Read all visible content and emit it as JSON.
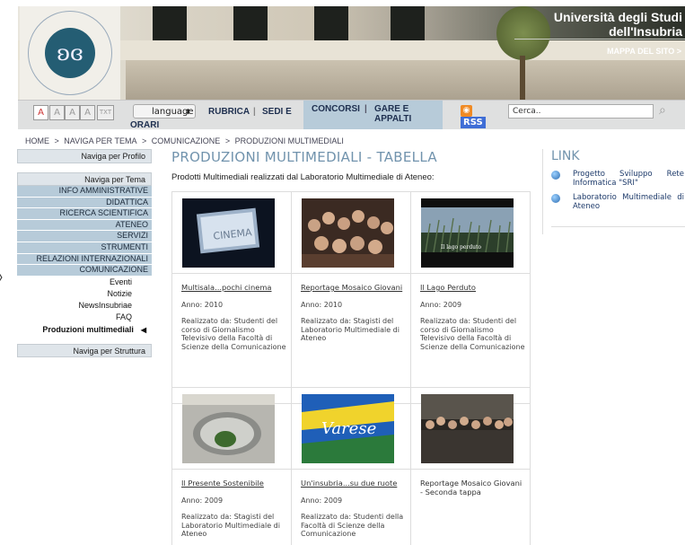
{
  "header": {
    "university_line1": "Università degli Studi",
    "university_line2": "dell'Insubria",
    "sitemap_label": "MAPPA DEL SITO >",
    "logo_ring_text": "STUDIORUM UNIVERSITAS INSUBRIAE"
  },
  "toolbar": {
    "font_buttons": [
      "A",
      "A",
      "A",
      "A",
      "TXT"
    ],
    "language_label": "language",
    "orari_label": "ORARI",
    "rubrica": "RUBRICA",
    "sedi": "SEDI E",
    "concorsi": "CONCORSI",
    "gare": "GARE E APPALTI",
    "separator": "|",
    "rss_label": "RSS",
    "search_value": "Cerca.."
  },
  "breadcrumb": [
    "HOME",
    ">",
    "NAVIGA PER TEMA",
    ">",
    "COMUNICAZIONE",
    ">",
    "PRODUZIONI MULTIMEDIALI"
  ],
  "leftnav": {
    "profilo": "Naviga per Profilo",
    "tema": "Naviga per Tema",
    "items": [
      "INFO AMMINISTRATIVE",
      "DIDATTICA",
      "RICERCA SCIENTIFICA",
      "ATENEO",
      "SERVIZI",
      "STRUMENTI",
      "RELAZIONI INTERNAZIONALI",
      "COMUNICAZIONE"
    ],
    "subitems": [
      "Eventi",
      "Notizie",
      "NewsInsubriae",
      "FAQ"
    ],
    "selected": "Produzioni multimediali",
    "struttura": "Naviga per Struttura"
  },
  "main": {
    "title": "PRODUZIONI MULTIMEDIALI - TABELLA",
    "intro": "Prodotti Multimediali realizzati dal Laboratorio Multimediale di Ateneo:",
    "row1": [
      {
        "title": "Multisala...pochi cinema",
        "year": "Anno: 2010",
        "desc": "Realizzato da: Studenti del corso di Giornalismo Televisivo della Facoltà di Scienze della Comunicazione",
        "thumb_text": "CINEMA"
      },
      {
        "title": "Reportage Mosaico Giovani",
        "year": "Anno: 2010",
        "desc": "Realizzato da: Stagisti del Laboratorio Multimediale di Ateneo",
        "thumb_text": ""
      },
      {
        "title": "Il Lago Perduto",
        "year": "Anno: 2009",
        "desc": "Realizzato da: Studenti del corso di Giornalismo Televisivo della Facoltà di Scienze della Comunicazione",
        "thumb_text": "Il lago perduto"
      }
    ],
    "row2": [
      {
        "title": "Il Presente Sostenibile",
        "year": "Anno: 2009",
        "desc": "Realizzato da: Stagisti del Laboratorio Multimediale di Ateneo",
        "thumb_text": ""
      },
      {
        "title": "Un'insubria...su due ruote",
        "year": "Anno: 2009",
        "desc": "Realizzato da: Studenti della Facoltà di Scienze della Comunicazione",
        "thumb_text": "Varese"
      },
      {
        "title": "Reportage Mosaico Giovani - Seconda tappa",
        "year": "",
        "desc": "",
        "thumb_text": ""
      }
    ]
  },
  "right": {
    "title": "LINK",
    "links": [
      "Progetto Sviluppo Rete Informatica \"SRI\"",
      "Laboratorio Multimediale di Ateneo"
    ]
  },
  "colors": {
    "accent": "#7193ad",
    "nav_bg": "#b7cbd9",
    "link": "#1d3a6a"
  }
}
